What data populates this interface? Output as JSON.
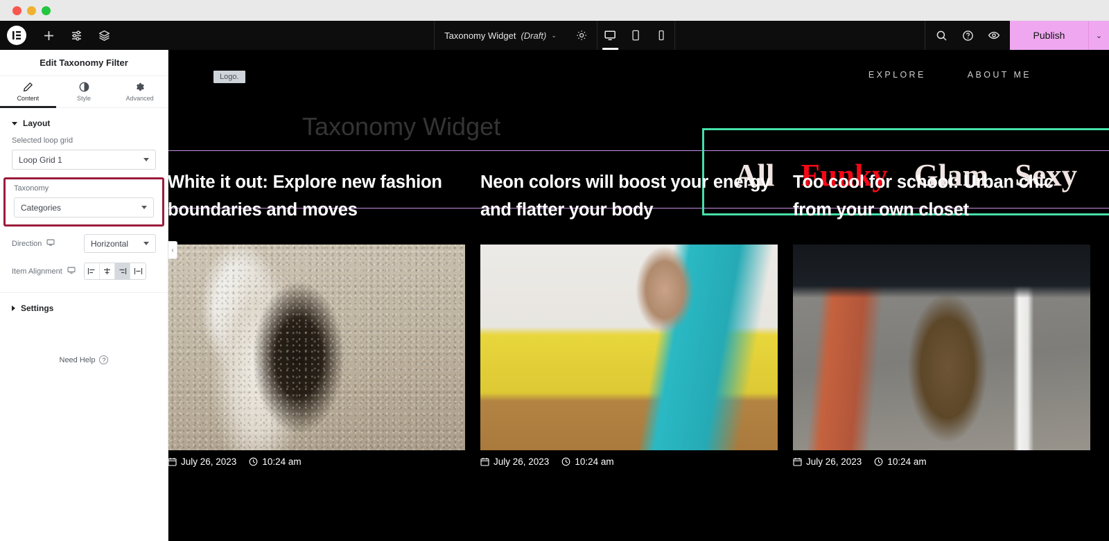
{
  "window": {
    "traffic_lights": [
      "close",
      "minimize",
      "maximize"
    ]
  },
  "topbar": {
    "logo": "elementor-logo-icon",
    "left_icons": [
      "add-element-icon",
      "settings-sliders-icon",
      "navigator-layers-icon"
    ],
    "document_title": "Taxonomy Widget",
    "document_status": "(Draft)",
    "title_chevron": "⌄",
    "gear": "gear-icon",
    "devices": [
      {
        "name": "desktop",
        "active": true
      },
      {
        "name": "tablet",
        "active": false
      },
      {
        "name": "mobile",
        "active": false
      }
    ],
    "right_icons": [
      "search-icon",
      "help-icon",
      "preview-eye-icon"
    ],
    "publish_label": "Publish",
    "publish_chevron": "⌄",
    "publish_color": "#efa8f0"
  },
  "panel": {
    "header_title": "Edit Taxonomy Filter",
    "tabs": [
      {
        "label": "Content",
        "icon": "pencil-icon",
        "active": true
      },
      {
        "label": "Style",
        "icon": "contrast-circle-icon",
        "active": false
      },
      {
        "label": "Advanced",
        "icon": "gear-icon",
        "active": false
      }
    ],
    "layout_section": {
      "title": "Layout",
      "expanded": true,
      "selected_loop_grid_label": "Selected loop grid",
      "selected_loop_grid_value": "Loop Grid 1",
      "taxonomy_label": "Taxonomy",
      "taxonomy_value": "Categories",
      "taxonomy_highlight_color": "#9b1b3c",
      "direction_label": "Direction",
      "direction_value": "Horizontal",
      "item_alignment_label": "Item Alignment",
      "alignment_options": [
        {
          "name": "align-start",
          "active": false
        },
        {
          "name": "align-center",
          "active": false
        },
        {
          "name": "align-end",
          "active": true
        },
        {
          "name": "align-stretch",
          "active": false
        }
      ]
    },
    "settings_section": {
      "title": "Settings",
      "expanded": false
    },
    "need_help_label": "Need Help",
    "collapse_chevron": "‹"
  },
  "canvas": {
    "logo_text": "Logo.",
    "nav": [
      {
        "label": "EXPLORE"
      },
      {
        "label": "ABOUT ME"
      }
    ],
    "hero_title": "Taxonomy Widget",
    "selection_border_color": "#45e0a8",
    "container_guide_color": "#c88fe8",
    "taxonomy_filter": {
      "active_color": "#f40816",
      "inactive_color": "#efe4e1",
      "items": [
        {
          "label": "All",
          "active": false
        },
        {
          "label": "Funky",
          "active": true
        },
        {
          "label": "Glam",
          "active": false
        },
        {
          "label": "Sexy",
          "active": false
        }
      ]
    },
    "posts": [
      {
        "title": "White it out: Explore new fashion boundaries and moves",
        "date": "July 26, 2023",
        "time": "10:24 am",
        "image": "woman-in-white-suit-on-sand"
      },
      {
        "title": "Neon colors will boost your energy and flatter your body",
        "date": "July 26, 2023",
        "time": "10:24 am",
        "image": "woman-on-yellow-sofa-in-teal-tights"
      },
      {
        "title": "Too cool for school: Urban chic from your own closet",
        "date": "July 26, 2023",
        "time": "10:24 am",
        "image": "woman-in-brown-outfit-by-brick-wall-and-mirror"
      }
    ]
  }
}
